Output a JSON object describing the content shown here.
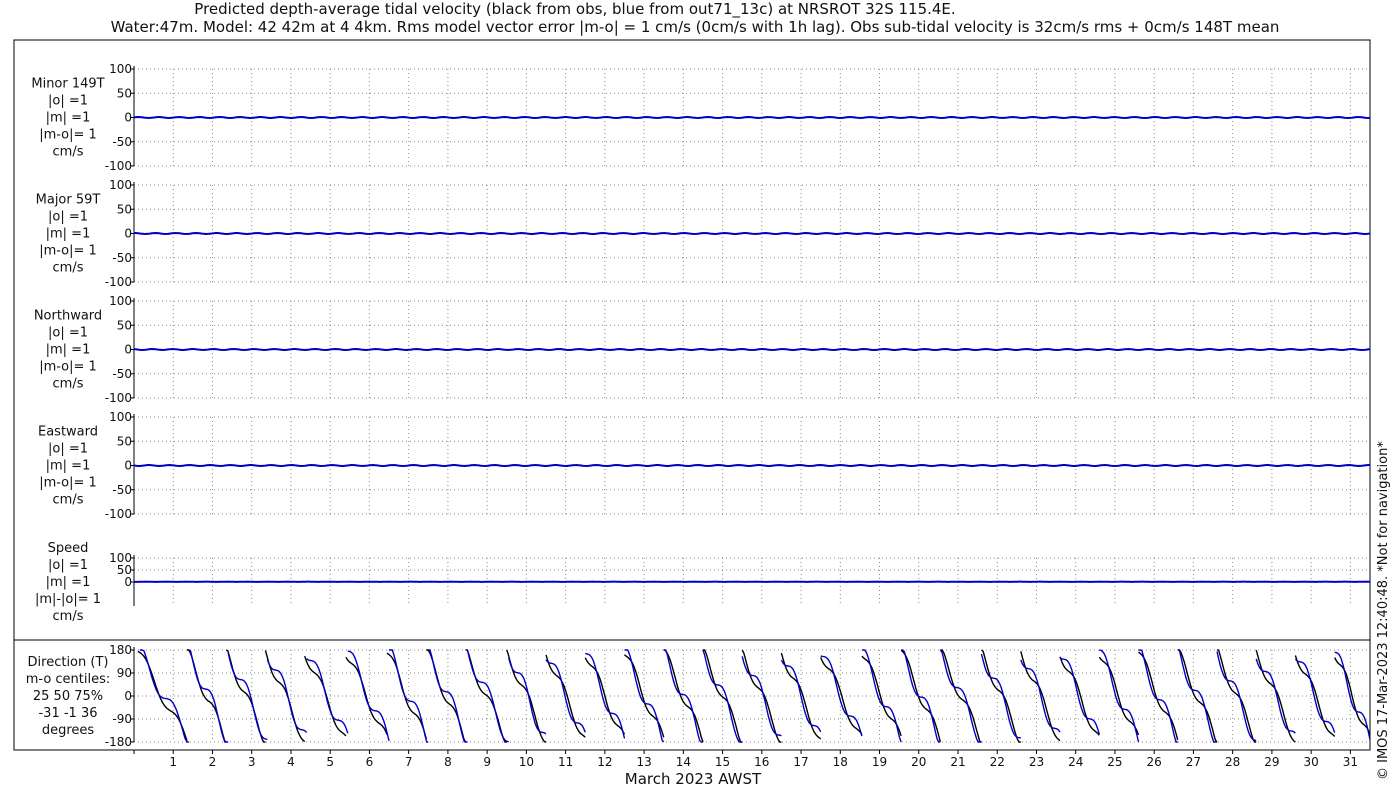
{
  "header": {
    "title_line1": "Predicted depth-average tidal velocity (black from obs, blue from out71_13c) at NRSROT 32S 115.4E.",
    "title_line2": "Water:47m. Model: 42 42m at 4 4km. Rms model vector error |m-o| = 1 cm/s (0cm/s with 1h lag). Obs sub-tidal velocity is 32cm/s rms + 0cm/s 148T mean"
  },
  "side_note": "© IMOS 17-Mar-2023 12:40:48. *Not for navigation*",
  "colors": {
    "obs": "#000000",
    "model": "#0000cc",
    "grid": "#888888"
  },
  "chart_data": {
    "type": "line",
    "xlabel": "March 2023 AWST",
    "x_ticks": [
      "1",
      "2",
      "3",
      "4",
      "5",
      "6",
      "7",
      "8",
      "9",
      "10",
      "11",
      "12",
      "13",
      "14",
      "15",
      "16",
      "17",
      "18",
      "19",
      "20",
      "21",
      "22",
      "23",
      "24",
      "25",
      "26",
      "27",
      "28",
      "29",
      "30",
      "31"
    ],
    "xlim": [
      0,
      31.5
    ],
    "panels": [
      {
        "label_lines": [
          "Minor 149T",
          "|o| =1",
          "|m| =1",
          "|m-o|= 1",
          "cm/s"
        ],
        "ylim": [
          -100,
          100
        ],
        "yticks": [
          "100",
          "50",
          "0",
          "-50",
          "-100"
        ],
        "tick_values": [
          100,
          50,
          0,
          -50,
          -100
        ],
        "series": [
          {
            "values_summary": "near 0 cm/s throughout, ripple about 1 cm/s",
            "amplitude": 1,
            "mean": 0
          }
        ]
      },
      {
        "label_lines": [
          "Major 59T",
          "|o| =1",
          "|m| =1",
          "|m-o|= 1",
          "cm/s"
        ],
        "ylim": [
          -100,
          100
        ],
        "yticks": [
          "100",
          "50",
          "0",
          "-50",
          "-100"
        ],
        "tick_values": [
          100,
          50,
          0,
          -50,
          -100
        ],
        "series": [
          {
            "values_summary": "near 0 cm/s throughout, ripple about 1 cm/s",
            "amplitude": 1,
            "mean": 0
          }
        ]
      },
      {
        "label_lines": [
          "Northward",
          "|o| =1",
          "|m| =1",
          "|m-o|= 1",
          "cm/s"
        ],
        "ylim": [
          -100,
          100
        ],
        "yticks": [
          "100",
          "50",
          "0",
          "-50",
          "-100"
        ],
        "tick_values": [
          100,
          50,
          0,
          -50,
          -100
        ],
        "series": [
          {
            "values_summary": "near 0 cm/s throughout, ripple about 1 cm/s",
            "amplitude": 1,
            "mean": 0
          }
        ]
      },
      {
        "label_lines": [
          "Eastward",
          "|o| =1",
          "|m| =1",
          "|m-o|= 1",
          "cm/s"
        ],
        "ylim": [
          -100,
          100
        ],
        "yticks": [
          "100",
          "50",
          "0",
          "-50",
          "-100"
        ],
        "tick_values": [
          100,
          50,
          0,
          -50,
          -100
        ],
        "series": [
          {
            "values_summary": "near 0 cm/s throughout, ripple about 1 cm/s",
            "amplitude": 1,
            "mean": 0
          }
        ]
      },
      {
        "label_lines": [
          "Speed",
          "|o| =1",
          "|m| =1",
          "|m|-|o|= 1",
          "cm/s"
        ],
        "ylim": [
          -100,
          100
        ],
        "yticks": [
          "100",
          "50",
          "0"
        ],
        "tick_values": [
          100,
          50,
          0
        ],
        "series": [
          {
            "values_summary": "about 1 cm/s throughout",
            "amplitude": 0.5,
            "mean": 1
          }
        ]
      },
      {
        "label_lines": [
          "Direction (T)",
          "m-o centiles:",
          "25  50  75%",
          "-31  -1  36",
          "degrees"
        ],
        "ylim": [
          -180,
          180
        ],
        "yticks": [
          "180",
          "90",
          "0",
          "-90",
          "-180"
        ],
        "tick_values": [
          180,
          90,
          0,
          -90,
          -180
        ],
        "direction": {
          "description": "sawtooth: jumps to about 180 degrees once per day then falls toward -180 degrees over the day",
          "obs_jump_days": [
            0.1,
            1.35,
            2.35,
            3.35,
            4.35,
            5.4,
            6.45,
            7.45,
            8.45,
            9.5,
            10.5,
            11.5,
            12.5,
            13.5,
            14.5,
            15.5,
            16.5,
            17.5,
            18.55,
            19.55,
            20.55,
            21.6,
            22.6,
            23.6,
            24.6,
            25.6,
            26.6,
            27.6,
            28.6,
            29.6,
            30.6
          ],
          "model_jump_days": [
            0.15,
            1.4,
            2.4,
            3.4,
            4.4,
            5.45,
            6.5,
            7.5,
            8.5,
            9.55,
            10.5,
            11.5,
            12.5,
            13.5,
            14.5,
            15.5,
            16.5,
            17.5,
            18.55,
            19.55,
            20.55,
            21.6,
            22.6,
            23.6,
            24.6,
            25.6,
            26.6,
            27.6,
            28.6,
            29.6,
            30.6
          ]
        }
      }
    ]
  }
}
